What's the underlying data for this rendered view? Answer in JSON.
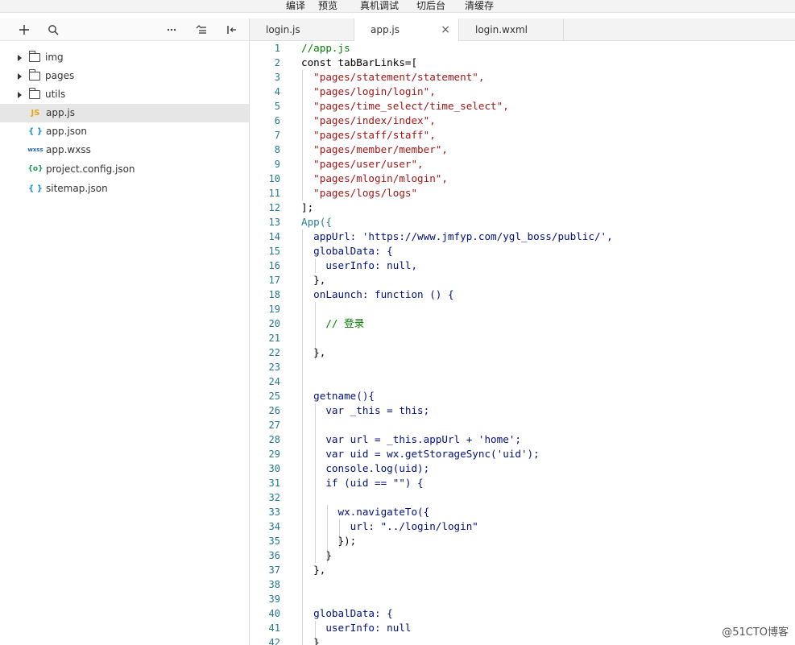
{
  "toolbar": {
    "compile": "编译",
    "preview": "预览",
    "remote_debug": "真机调试",
    "background": "切后台",
    "clear_cache": "清缓存"
  },
  "sidebar": {
    "tools": [
      "add-icon",
      "search-icon",
      "more-icon",
      "collapse-icon",
      "split-icon"
    ],
    "items": [
      {
        "label": "img",
        "type": "folder"
      },
      {
        "label": "pages",
        "type": "folder"
      },
      {
        "label": "utils",
        "type": "folder"
      },
      {
        "label": "app.js",
        "type": "js",
        "icon_text": "JS",
        "selected": true
      },
      {
        "label": "app.json",
        "type": "json",
        "icon_text": "{ }"
      },
      {
        "label": "app.wxss",
        "type": "wxss",
        "icon_text": "wxss"
      },
      {
        "label": "project.config.json",
        "type": "config",
        "icon_text": "{o}"
      },
      {
        "label": "sitemap.json",
        "type": "json",
        "icon_text": "{ }"
      }
    ]
  },
  "tabs": [
    {
      "label": "login.js",
      "active": false
    },
    {
      "label": "app.js",
      "active": true,
      "close": "×"
    },
    {
      "label": "login.wxml",
      "active": false
    }
  ],
  "editor": {
    "lines": [
      "1",
      "2",
      "3",
      "4",
      "5",
      "6",
      "7",
      "8",
      "9",
      "10",
      "11",
      "12",
      "13",
      "14",
      "15",
      "16",
      "17",
      "18",
      "19",
      "20",
      "21",
      "22",
      "23",
      "24",
      "25",
      "26",
      "27",
      "28",
      "29",
      "30",
      "31",
      "32",
      "33",
      "34",
      "35",
      "36",
      "37",
      "38",
      "39",
      "40",
      "41",
      "42"
    ],
    "code": [
      "//app.js",
      "const tabBarLinks=[",
      "  \"pages/statement/statement\",",
      "  \"pages/login/login\",",
      "  \"pages/time_select/time_select\",",
      "  \"pages/index/index\",",
      "  \"pages/staff/staff\",",
      "  \"pages/member/member\",",
      "  \"pages/user/user\",",
      "  \"pages/mlogin/mlogin\",",
      "  \"pages/logs/logs\"",
      "];",
      "App({",
      "  appUrl: 'https://www.jmfyp.com/ygl_boss/public/',",
      "  globalData: {",
      "    userInfo: null,",
      "  },",
      "  onLaunch: function () {",
      "",
      "    // 登录",
      "",
      "  },",
      "",
      "",
      "  getname(){",
      "    var _this = this;",
      "",
      "    var url = _this.appUrl + 'home';",
      "    var uid = wx.getStorageSync('uid');",
      "    console.log(uid);",
      "    if (uid == \"\") {",
      "",
      "      wx.navigateTo({",
      "        url: \"../login/login\"",
      "      });",
      "    }",
      "  },",
      "",
      "",
      "  globalData: {",
      "    userInfo: null",
      "  }"
    ]
  },
  "watermark": "@51CTO博客"
}
